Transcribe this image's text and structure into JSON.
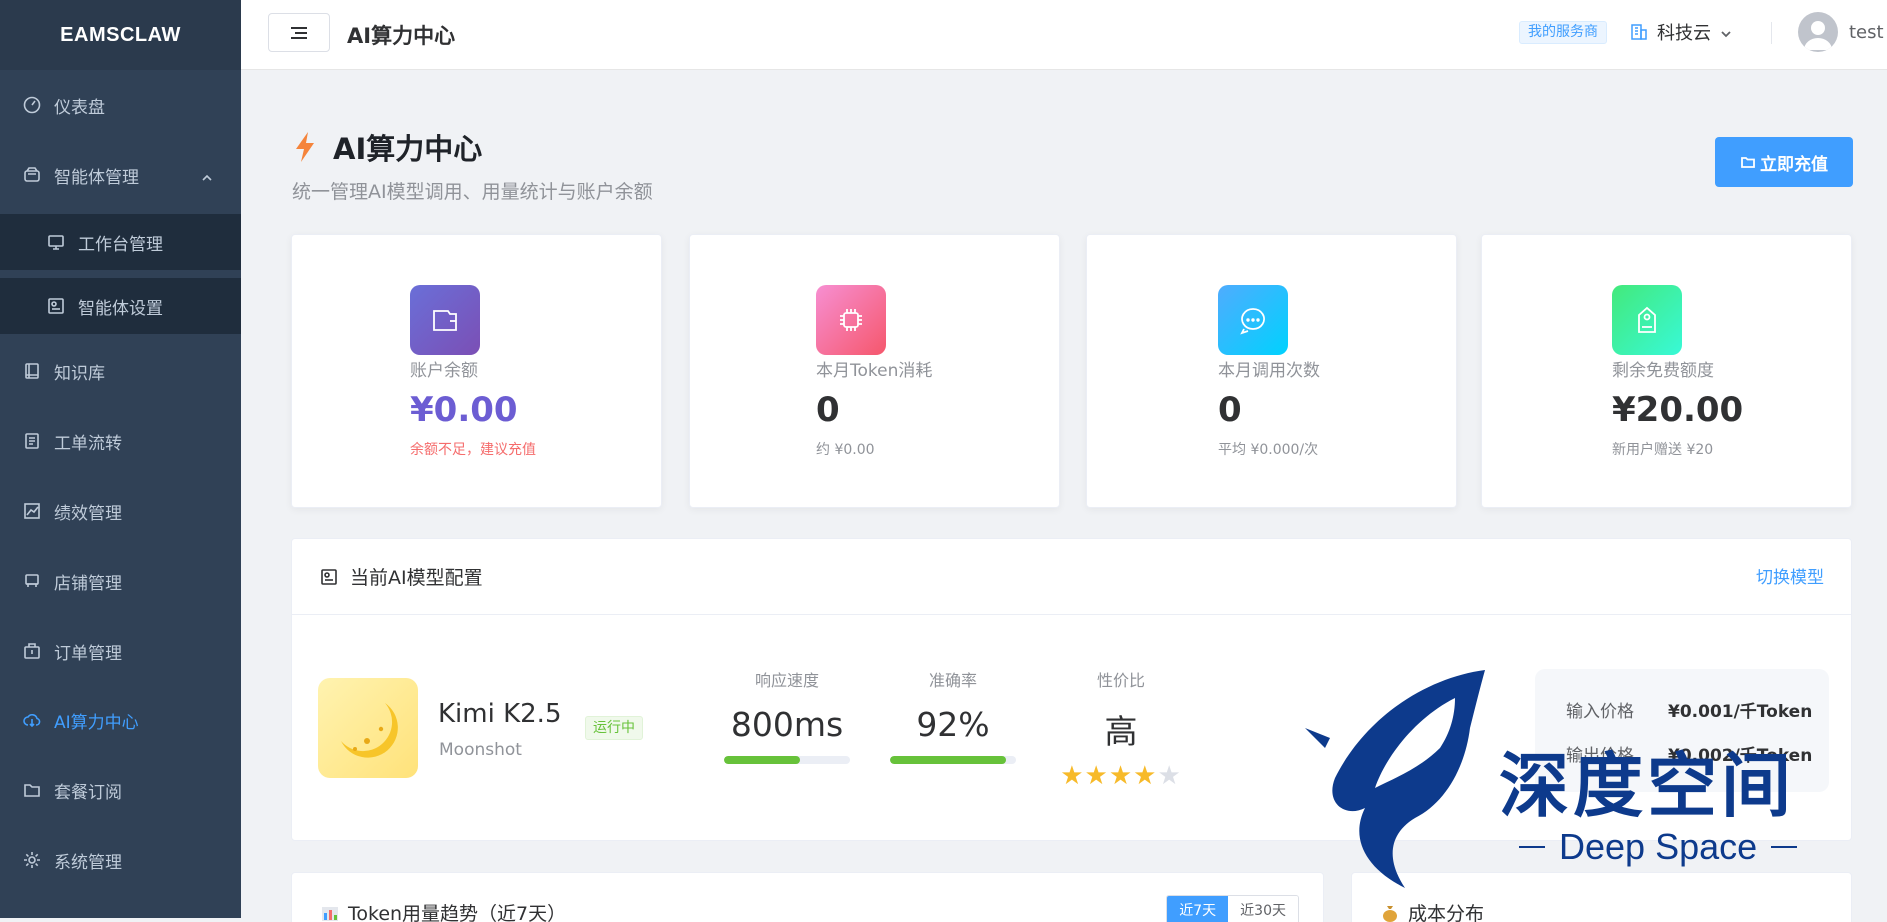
{
  "brand": "EAMSCLAW",
  "sidebar": {
    "items": [
      {
        "label": "仪表盘",
        "icon": "dashboard-icon"
      },
      {
        "label": "智能体管理",
        "icon": "robot-icon",
        "expanded": true
      },
      {
        "label": "工作台管理",
        "icon": "monitor-icon",
        "sub": true
      },
      {
        "label": "智能体设置",
        "icon": "settings-panel-icon",
        "sub": true
      },
      {
        "label": "知识库",
        "icon": "book-icon"
      },
      {
        "label": "工单流转",
        "icon": "document-icon"
      },
      {
        "label": "绩效管理",
        "icon": "chart-icon"
      },
      {
        "label": "店铺管理",
        "icon": "shop-icon"
      },
      {
        "label": "订单管理",
        "icon": "briefcase-icon"
      },
      {
        "label": "AI算力中心",
        "icon": "cloud-icon",
        "active": true
      },
      {
        "label": "套餐订阅",
        "icon": "folder-icon"
      },
      {
        "label": "系统管理",
        "icon": "gear-icon"
      }
    ]
  },
  "header": {
    "title": "AI算力中心",
    "provider_tag": "我的服务商",
    "company": "科技云",
    "username": "test"
  },
  "page": {
    "title": "AI算力中心",
    "subtitle": "统一管理AI模型调用、用量统计与账户余额",
    "recharge_label": "立即充值"
  },
  "stats": [
    {
      "label": "账户余额",
      "value": "¥0.00",
      "note": "余额不足，建议充值",
      "color": "#6c5dd3",
      "note_color": "#f56c6c",
      "icon": "wallet-icon"
    },
    {
      "label": "本月Token消耗",
      "value": "0",
      "note": "约 ¥0.00",
      "color": "#f56cb8",
      "note_color": "#909399",
      "icon": "cpu-icon"
    },
    {
      "label": "本月调用次数",
      "value": "0",
      "note": "平均 ¥0.000/次",
      "color": "#36b6ff",
      "note_color": "#909399",
      "icon": "chat-icon"
    },
    {
      "label": "剩余免费额度",
      "value": "¥20.00",
      "note": "新用户赠送 ¥20",
      "color": "#3ddc97",
      "note_color": "#909399",
      "icon": "tag-icon"
    }
  ],
  "model_config": {
    "title": "当前AI模型配置",
    "switch_label": "切换模型",
    "model_name": "Kimi K2.5",
    "vendor": "Moonshot",
    "status": "运行中",
    "metrics": [
      {
        "label": "响应速度",
        "value": "800ms",
        "progress": 0.6
      },
      {
        "label": "准确率",
        "value": "92%",
        "progress": 0.92
      },
      {
        "label": "性价比",
        "value": "高",
        "rating": 4,
        "rating_max": 5
      }
    ],
    "prices": [
      {
        "label": "输入价格",
        "value": "¥0.001/千Token"
      },
      {
        "label": "输出价格",
        "value": "¥0.002/千Token"
      }
    ]
  },
  "trend_card": {
    "title": "Token用量趋势（近7天）",
    "tabs": [
      "近7天",
      "近30天"
    ],
    "active_tab": "近7天"
  },
  "cost_card": {
    "title": "成本分布"
  },
  "watermark": {
    "cn": "深度空间",
    "en": "Deep Space"
  }
}
